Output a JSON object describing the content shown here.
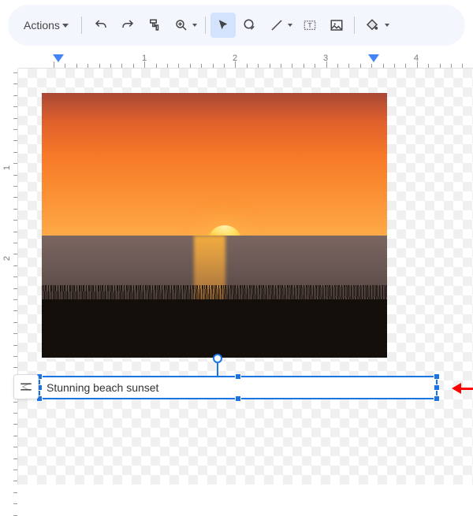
{
  "toolbar": {
    "actions_label": "Actions",
    "icons": [
      "undo",
      "redo",
      "paint-format",
      "zoom",
      "select",
      "shape",
      "line",
      "textbox",
      "image",
      "fill"
    ]
  },
  "ruler": {
    "h_labels": [
      "1",
      "2",
      "3",
      "4"
    ],
    "v_labels": [
      "1",
      "2"
    ],
    "indent_markers": [
      44,
      444
    ]
  },
  "textbox": {
    "value": "Stunning beach sunset"
  }
}
